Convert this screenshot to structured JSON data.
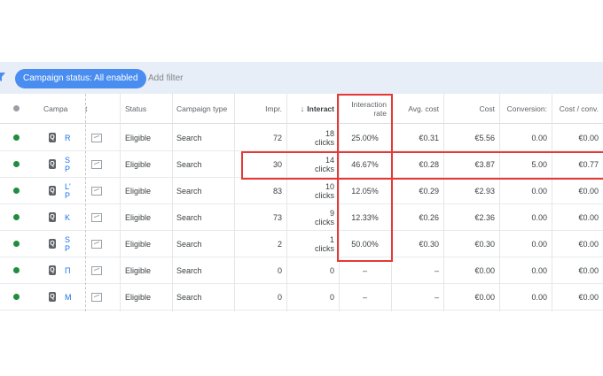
{
  "filterbar": {
    "chip_label": "Campaign status: All enabled",
    "add_filter": "Add filter"
  },
  "columns": {
    "campaign": "Campa",
    "ad": "t",
    "status": "Status",
    "campaign_type": "Campaign type",
    "impr": "Impr.",
    "interactions": "Interact",
    "interaction_rate": "Interaction rate",
    "avg_cost": "Avg. cost",
    "cost": "Cost",
    "conversions": "Conversion:",
    "cost_conv": "Cost / conv."
  },
  "rows": [
    {
      "name_line1": "R",
      "name_line2": "",
      "status": "Eligible",
      "type": "Search",
      "impr": "72",
      "interactions_num": "18",
      "interactions_unit": "clicks",
      "rate": "25.00%",
      "avg_cost": "€0.31",
      "cost": "€5.56",
      "conversions": "0.00",
      "cost_conv": "€0.00"
    },
    {
      "name_line1": "S",
      "name_line2": "P",
      "status": "Eligible",
      "type": "Search",
      "impr": "30",
      "interactions_num": "14",
      "interactions_unit": "clicks",
      "rate": "46.67%",
      "avg_cost": "€0.28",
      "cost": "€3.87",
      "conversions": "5.00",
      "cost_conv": "€0.77"
    },
    {
      "name_line1": "L'",
      "name_line2": "P",
      "status": "Eligible",
      "type": "Search",
      "impr": "83",
      "interactions_num": "10",
      "interactions_unit": "clicks",
      "rate": "12.05%",
      "avg_cost": "€0.29",
      "cost": "€2.93",
      "conversions": "0.00",
      "cost_conv": "€0.00"
    },
    {
      "name_line1": "K",
      "name_line2": "",
      "status": "Eligible",
      "type": "Search",
      "impr": "73",
      "interactions_num": "9",
      "interactions_unit": "clicks",
      "rate": "12.33%",
      "avg_cost": "€0.26",
      "cost": "€2.36",
      "conversions": "0.00",
      "cost_conv": "€0.00"
    },
    {
      "name_line1": "S",
      "name_line2": "P",
      "status": "Eligible",
      "type": "Search",
      "impr": "2",
      "interactions_num": "1",
      "interactions_unit": "clicks",
      "rate": "50.00%",
      "avg_cost": "€0.30",
      "cost": "€0.30",
      "conversions": "0.00",
      "cost_conv": "€0.00"
    },
    {
      "name_line1": "П",
      "name_line2": "",
      "status": "Eligible",
      "type": "Search",
      "impr": "0",
      "interactions_num": "0",
      "interactions_unit": "",
      "rate": "–",
      "avg_cost": "–",
      "cost": "€0.00",
      "conversions": "0.00",
      "cost_conv": "€0.00"
    },
    {
      "name_line1": "M",
      "name_line2": "",
      "status": "Eligible",
      "type": "Search",
      "impr": "0",
      "interactions_num": "0",
      "interactions_unit": "",
      "rate": "–",
      "avg_cost": "–",
      "cost": "€0.00",
      "conversions": "0.00",
      "cost_conv": "€0.00"
    }
  ],
  "icons": {
    "filter": "funnel-icon",
    "status_dot": "status-dot-icon",
    "campaign": "search-campaign-icon",
    "ad_preview": "image-placeholder-icon",
    "sort": "arrow-down-icon"
  },
  "colors": {
    "accent": "#4a8df0",
    "enabled": "#1e8e3e",
    "highlight": "#e53935",
    "link": "#1a73e8"
  }
}
